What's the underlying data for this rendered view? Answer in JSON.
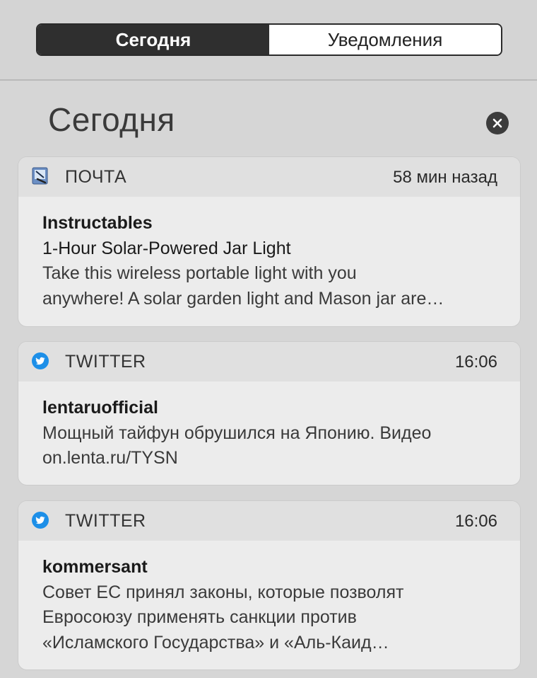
{
  "tabs": {
    "today": "Сегодня",
    "notifications": "Уведомления"
  },
  "heading": "Сегодня",
  "notifications": [
    {
      "app": "ПОЧТА",
      "icon": "mail-icon",
      "time": "58 мин назад",
      "sender": "Instructables",
      "subject": "1-Hour Solar-Powered Jar Light",
      "lines": [
        "Take this wireless portable light with you",
        "anywhere! A solar garden light and Mason jar are…"
      ]
    },
    {
      "app": "TWITTER",
      "icon": "twitter-bird-icon",
      "time": "16:06",
      "sender": "lentaruofficial",
      "lines": [
        "Мощный тайфун обрушился на Японию. Видео",
        "on.lenta.ru/TYSN"
      ]
    },
    {
      "app": "TWITTER",
      "icon": "twitter-bird-icon",
      "time": "16:06",
      "sender": "kommersant",
      "lines": [
        "Совет ЕС принял законы, которые позволят",
        "Евросоюзу применять санкции против",
        "«Исламского Государства» и «Аль-Каид…"
      ]
    }
  ],
  "colors": {
    "background": "#d6d6d6",
    "card": "#ececec",
    "card_header": "#e0e0e0",
    "segment_active": "#2f2f2f",
    "twitter_blue": "#1d8fe8"
  }
}
